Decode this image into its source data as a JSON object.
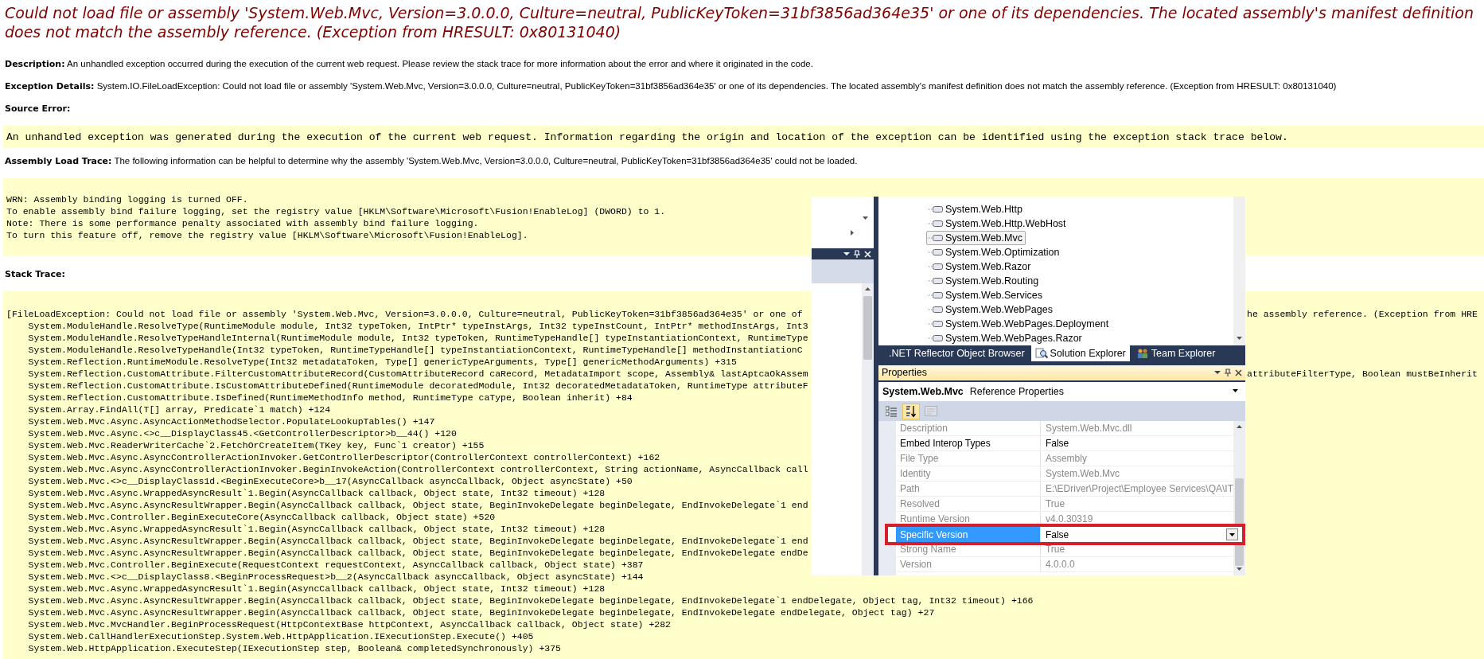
{
  "error_title": "Could not load file or assembly 'System.Web.Mvc, Version=3.0.0.0, Culture=neutral, PublicKeyToken=31bf3856ad364e35' or one of its dependencies. The located assembly's manifest definition does not match the assembly reference. (Exception from HRESULT: 0x80131040)",
  "details": [
    {
      "label": "Description:",
      "text": "An unhandled exception occurred during the execution of the current web request. Please review the stack trace for more information about the error and where it originated in the code."
    },
    {
      "label": "Exception Details:",
      "text": "System.IO.FileLoadException: Could not load file or assembly 'System.Web.Mvc, Version=3.0.0.0, Culture=neutral, PublicKeyToken=31bf3856ad364e35' or one of its dependencies. The located assembly's manifest definition does not match the assembly reference. (Exception from HRESULT: 0x80131040)"
    }
  ],
  "source_error": {
    "heading": "Source Error:",
    "code": "An unhandled exception was generated during the execution of the current web request. Information regarding the origin and location of the exception can be identified using the exception stack trace below."
  },
  "assembly_load_trace": {
    "label": "Assembly Load Trace:",
    "text": "The following information can be helpful to determine why the assembly 'System.Web.Mvc, Version=3.0.0.0, Culture=neutral, PublicKeyToken=31bf3856ad364e35' could not be loaded.",
    "log": [
      "WRN: Assembly binding logging is turned OFF.",
      "To enable assembly bind failure logging, set the registry value [HKLM\\Software\\Microsoft\\Fusion!EnableLog] (DWORD) to 1.",
      "Note: There is some performance penalty associated with assembly bind failure logging.",
      "To turn this feature off, remove the registry value [HKLM\\Software\\Microsoft\\Fusion!EnableLog]."
    ]
  },
  "stack_trace": {
    "heading": "Stack Trace:",
    "lines": [
      {
        "kind": "exception",
        "text": "[FileLoadException: Could not load file or assembly 'System.Web.Mvc, Version=3.0.0.0, Culture=neutral, PublicKeyToken=31bf3856ad364e35' or one of",
        "right": "he assembly reference. (Exception from HRE"
      },
      {
        "kind": "frame",
        "text": "System.ModuleHandle.ResolveType(RuntimeModule module, Int32 typeToken, IntPtr* typeInstArgs, Int32 typeInstCount, IntPtr* methodInstArgs, Int3"
      },
      {
        "kind": "frame",
        "text": "System.ModuleHandle.ResolveTypeHandleInternal(RuntimeModule module, Int32 typeToken, RuntimeTypeHandle[] typeInstantiationContext, RuntimeType"
      },
      {
        "kind": "frame",
        "text": "System.ModuleHandle.ResolveTypeHandle(Int32 typeToken, RuntimeTypeHandle[] typeInstantiationContext, RuntimeTypeHandle[] methodInstantiationC"
      },
      {
        "kind": "frame",
        "text": "System.Reflection.RuntimeModule.ResolveType(Int32 metadataToken, Type[] genericTypeArguments, Type[] genericMethodArguments) +315"
      },
      {
        "kind": "frame",
        "text": "System.Reflection.CustomAttribute.FilterCustomAttributeRecord(CustomAttributeRecord caRecord, MetadataImport scope, Assembly& lastAptcaOkAssem",
        "right": "attributeFilterType, Boolean mustBeInherit"
      },
      {
        "kind": "frame",
        "text": "System.Reflection.CustomAttribute.IsCustomAttributeDefined(RuntimeModule decoratedModule, Int32 decoratedMetadataToken, RuntimeType attributeF"
      },
      {
        "kind": "frame",
        "text": "System.Reflection.CustomAttribute.IsDefined(RuntimeMethodInfo method, RuntimeType caType, Boolean inherit) +84"
      },
      {
        "kind": "frame",
        "text": "System.Array.FindAll(T[] array, Predicate`1 match) +124"
      },
      {
        "kind": "frame",
        "text": "System.Web.Mvc.Async.AsyncActionMethodSelector.PopulateLookupTables() +147"
      },
      {
        "kind": "frame",
        "text": "System.Web.Mvc.Async.<>c__DisplayClass45.<GetControllerDescriptor>b__44() +120"
      },
      {
        "kind": "frame",
        "text": "System.Web.Mvc.ReaderWriterCache`2.FetchOrCreateItem(TKey key, Func`1 creator) +155"
      },
      {
        "kind": "frame",
        "text": "System.Web.Mvc.Async.AsyncControllerActionInvoker.GetControllerDescriptor(ControllerContext controllerContext) +162"
      },
      {
        "kind": "frame",
        "text": "System.Web.Mvc.Async.AsyncControllerActionInvoker.BeginInvokeAction(ControllerContext controllerContext, String actionName, AsyncCallback call"
      },
      {
        "kind": "frame",
        "text": "System.Web.Mvc.<>c__DisplayClass1d.<BeginExecuteCore>b__17(AsyncCallback asyncCallback, Object asyncState) +50"
      },
      {
        "kind": "frame",
        "text": "System.Web.Mvc.Async.WrappedAsyncResult`1.Begin(AsyncCallback callback, Object state, Int32 timeout) +128"
      },
      {
        "kind": "frame",
        "text": "System.Web.Mvc.Async.AsyncResultWrapper.Begin(AsyncCallback callback, Object state, BeginInvokeDelegate beginDelegate, EndInvokeDelegate`1 end"
      },
      {
        "kind": "frame",
        "text": "System.Web.Mvc.Controller.BeginExecuteCore(AsyncCallback callback, Object state) +520"
      },
      {
        "kind": "frame",
        "text": "System.Web.Mvc.Async.WrappedAsyncResult`1.Begin(AsyncCallback callback, Object state, Int32 timeout) +128"
      },
      {
        "kind": "frame",
        "text": "System.Web.Mvc.Async.AsyncResultWrapper.Begin(AsyncCallback callback, Object state, BeginInvokeDelegate beginDelegate, EndInvokeDelegate`1 end"
      },
      {
        "kind": "frame",
        "text": "System.Web.Mvc.Async.AsyncResultWrapper.Begin(AsyncCallback callback, Object state, BeginInvokeDelegate beginDelegate, EndInvokeDelegate endDe"
      },
      {
        "kind": "frame",
        "text": "System.Web.Mvc.Controller.BeginExecute(RequestContext requestContext, AsyncCallback callback, Object state) +387"
      },
      {
        "kind": "frame",
        "text": "System.Web.Mvc.<>c__DisplayClass8.<BeginProcessRequest>b__2(AsyncCallback asyncCallback, Object asyncState) +144"
      },
      {
        "kind": "frame",
        "text": "System.Web.Mvc.Async.WrappedAsyncResult`1.Begin(AsyncCallback callback, Object state, Int32 timeout) +128"
      },
      {
        "kind": "frame",
        "text": "System.Web.Mvc.Async.AsyncResultWrapper.Begin(AsyncCallback callback, Object state, BeginInvokeDelegate beginDelegate, EndInvokeDelegate`1 endDelegate, Object tag, Int32 timeout) +166"
      },
      {
        "kind": "frame",
        "text": "System.Web.Mvc.Async.AsyncResultWrapper.Begin(AsyncCallback callback, Object state, BeginInvokeDelegate beginDelegate, EndInvokeDelegate endDelegate, Object tag) +27"
      },
      {
        "kind": "frame",
        "text": "System.Web.Mvc.MvcHandler.BeginProcessRequest(HttpContextBase httpContext, AsyncCallback callback, Object state) +282"
      },
      {
        "kind": "frame",
        "text": "System.Web.CallHandlerExecutionStep.System.Web.HttpApplication.IExecutionStep.Execute() +405"
      },
      {
        "kind": "frame",
        "text": "System.Web.HttpApplication.ExecuteStep(IExecutionStep step, Boolean& completedSynchronously) +375"
      }
    ]
  },
  "ide": {
    "tree_items": [
      {
        "label": "System.Web.Http",
        "selected": false
      },
      {
        "label": "System.Web.Http.WebHost",
        "selected": false
      },
      {
        "label": "System.Web.Mvc",
        "selected": true
      },
      {
        "label": "System.Web.Optimization",
        "selected": false
      },
      {
        "label": "System.Web.Razor",
        "selected": false
      },
      {
        "label": "System.Web.Routing",
        "selected": false
      },
      {
        "label": "System.Web.Services",
        "selected": false
      },
      {
        "label": "System.Web.WebPages",
        "selected": false
      },
      {
        "label": "System.Web.WebPages.Deployment",
        "selected": false
      },
      {
        "label": "System.Web.WebPages.Razor",
        "selected": false
      }
    ],
    "tabs": [
      {
        "kind": "browser",
        "label": ".NET Reflector Object Browser",
        "selected": false
      },
      {
        "kind": "solution",
        "label": "Solution Explorer",
        "selected": true
      },
      {
        "kind": "team",
        "label": "Team Explorer",
        "selected": false
      }
    ],
    "properties": {
      "title": "Properties",
      "object_name": "System.Web.Mvc",
      "object_type": "Reference Properties",
      "toolbar": [
        {
          "kind": "categorized",
          "selected": false,
          "disabled": false
        },
        {
          "kind": "alphabetical",
          "selected": true,
          "disabled": false
        },
        {
          "kind": "pages",
          "selected": false,
          "disabled": true
        }
      ],
      "rows": [
        {
          "name": "Description",
          "value": "System.Web.Mvc.dll",
          "read_only": true,
          "selected": false,
          "annotated": false
        },
        {
          "name": "Embed Interop Types",
          "value": "False",
          "read_only": false,
          "selected": false,
          "annotated": false
        },
        {
          "name": "File Type",
          "value": "Assembly",
          "read_only": true,
          "selected": false,
          "annotated": false
        },
        {
          "name": "Identity",
          "value": "System.Web.Mvc",
          "read_only": true,
          "selected": false,
          "annotated": false
        },
        {
          "name": "Path",
          "value": "E:\\EDriver\\Project\\Employee Services\\QA\\IT",
          "read_only": true,
          "selected": false,
          "annotated": false
        },
        {
          "name": "Resolved",
          "value": "True",
          "read_only": true,
          "selected": false,
          "annotated": false
        },
        {
          "name": "Runtime Version",
          "value": "v4.0.30319",
          "read_only": true,
          "selected": false,
          "annotated": false
        },
        {
          "name": "Specific Version",
          "value": "False",
          "read_only": false,
          "selected": true,
          "annotated": true
        },
        {
          "name": "Strong Name",
          "value": "True",
          "read_only": true,
          "selected": false,
          "annotated": false
        },
        {
          "name": "Version",
          "value": "4.0.0.0",
          "read_only": true,
          "selected": false,
          "annotated": false
        }
      ]
    }
  }
}
